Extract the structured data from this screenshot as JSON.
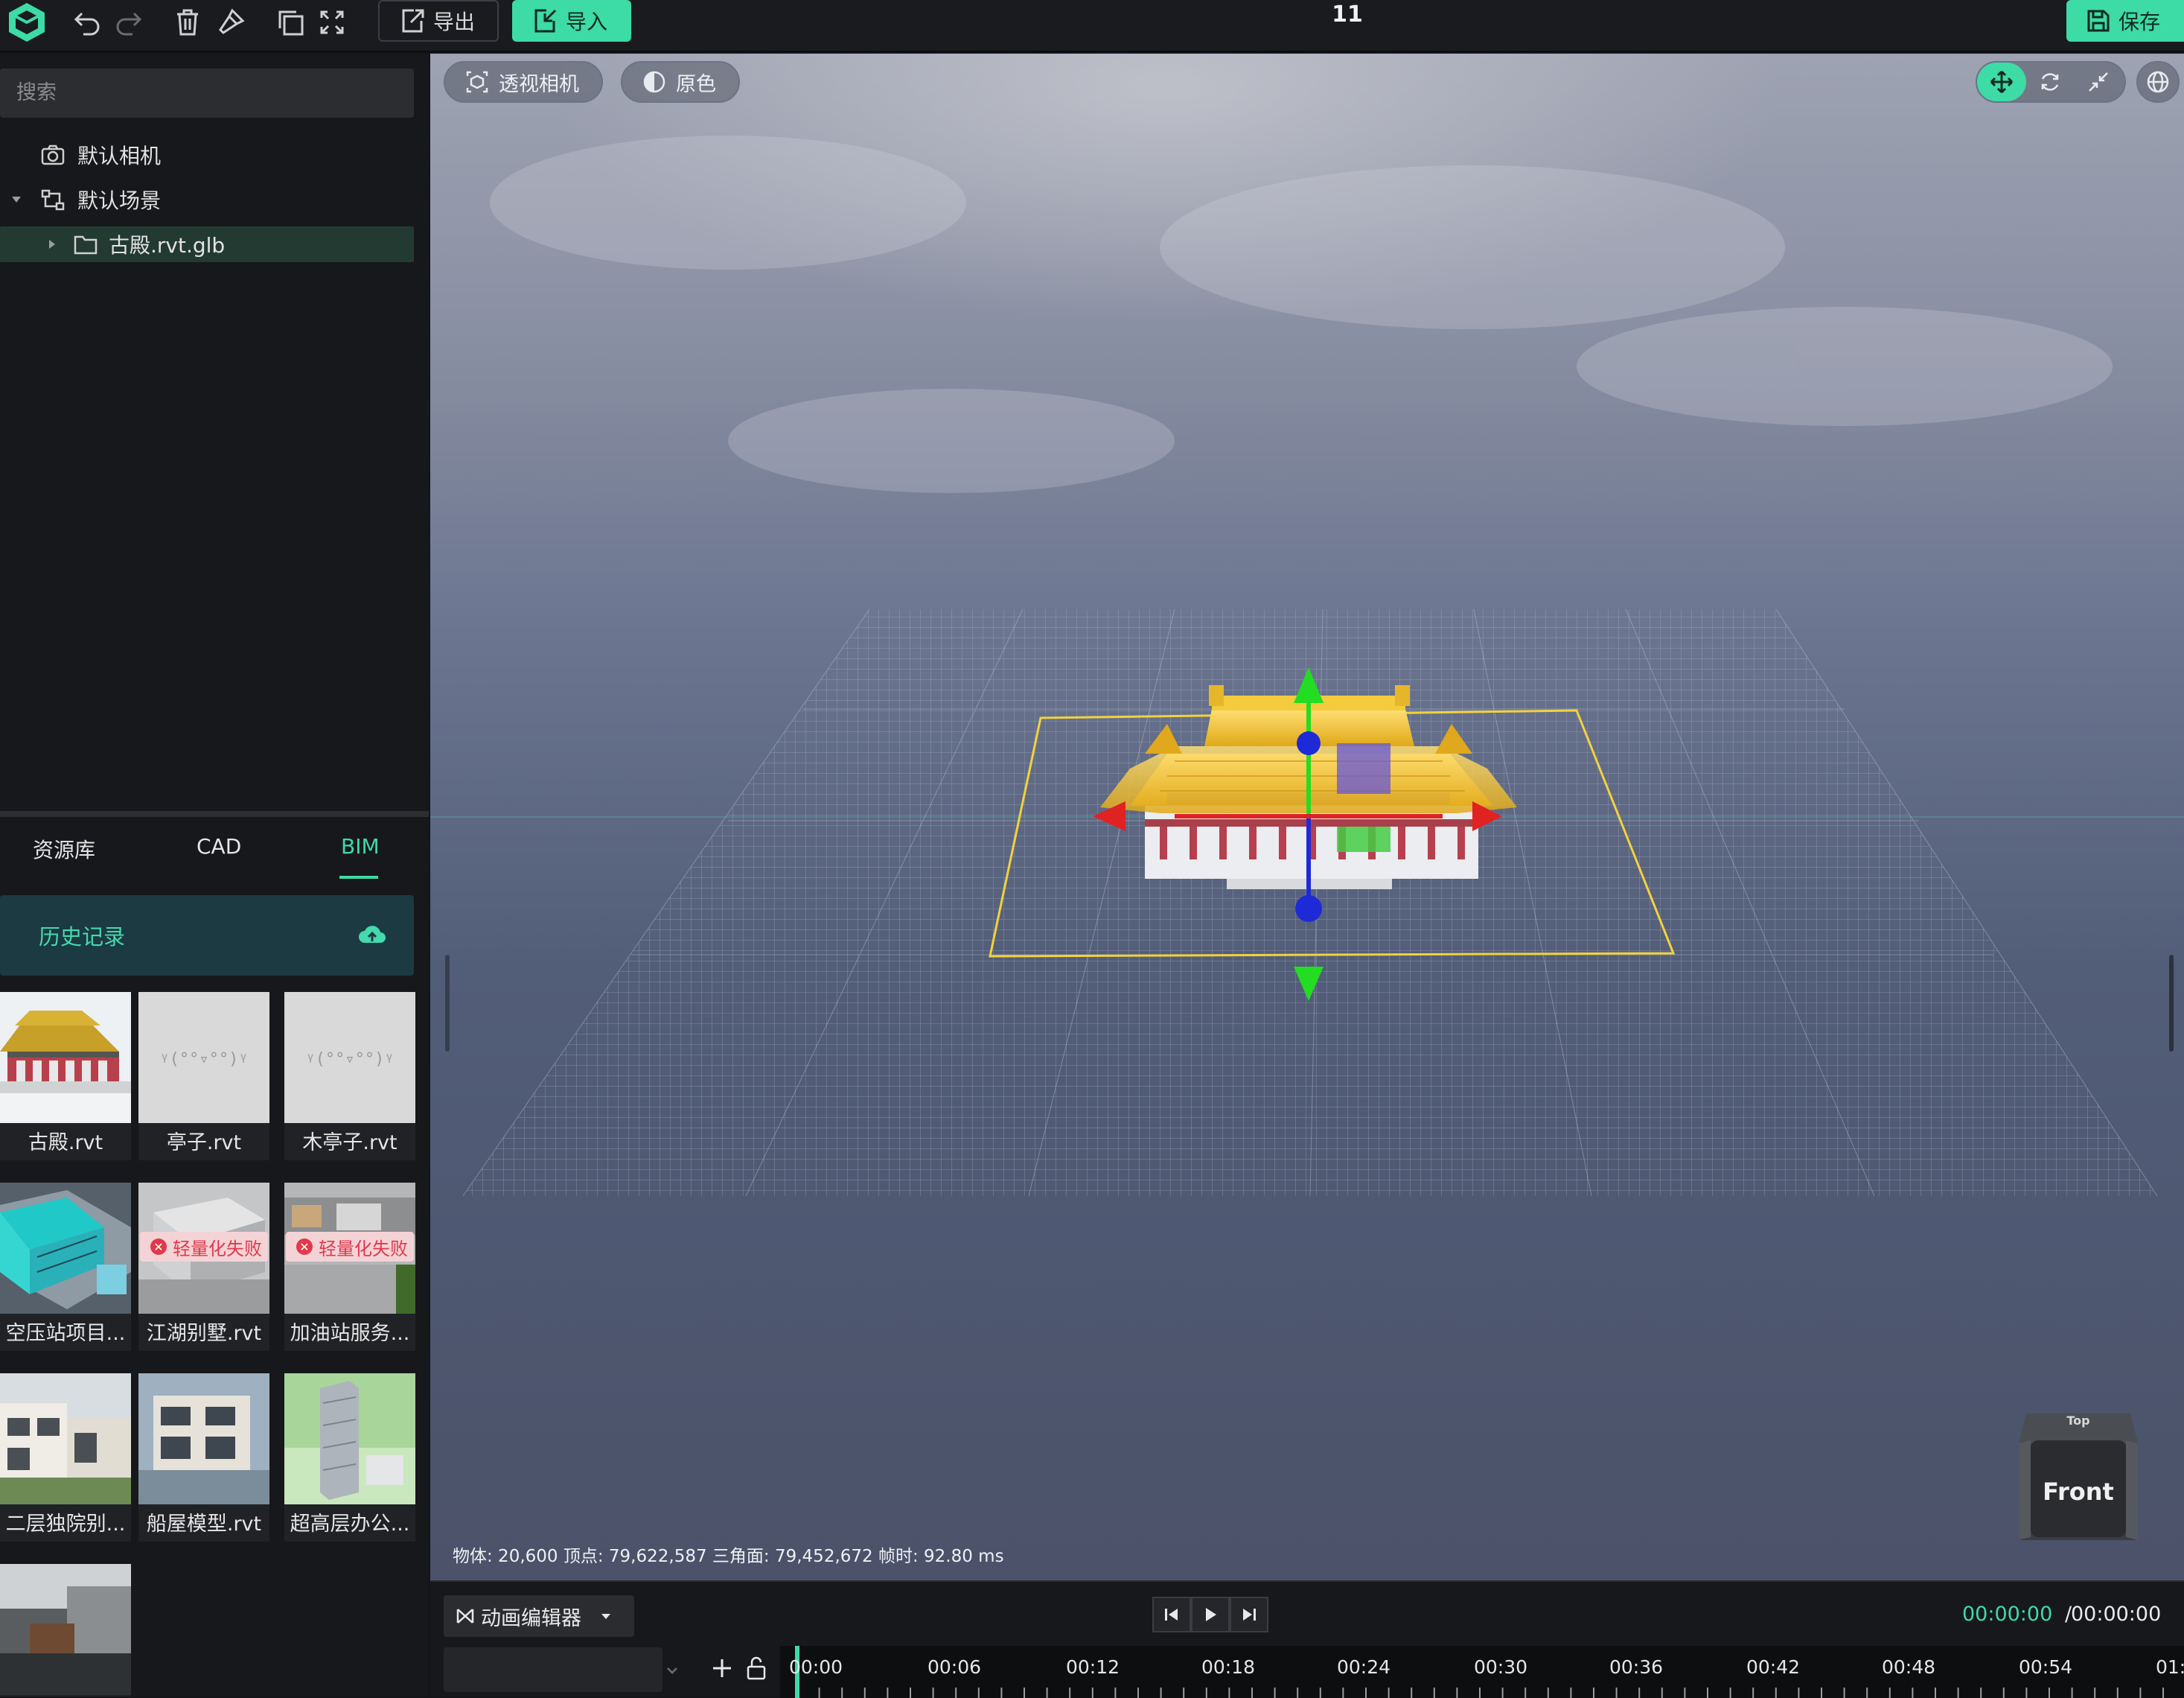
{
  "app": {
    "title": "11"
  },
  "toolbar": {
    "export_label": "导出",
    "import_label": "导入",
    "save_label": "保存"
  },
  "sidebar": {
    "search_placeholder": "搜索",
    "tree": [
      {
        "label": "默认相机",
        "icon": "camera-icon"
      },
      {
        "label": "默认场景",
        "icon": "scene-graph-icon"
      },
      {
        "label": "古殿.rvt.glb",
        "icon": "folder-icon"
      }
    ],
    "tabs": [
      "资源库",
      "CAD",
      "BIM"
    ],
    "active_tab": "BIM",
    "history_label": "历史记录",
    "fail_badge": "轻量化失败",
    "placeholder_face": "ᵞ(°°▿°°)ᵞ",
    "cards": [
      {
        "name": "古殿.rvt",
        "status": "ok"
      },
      {
        "name": "亭子.rvt",
        "status": "placeholder"
      },
      {
        "name": "木亭子.rvt",
        "status": "placeholder"
      },
      {
        "name": "空压站项目...",
        "status": "ok"
      },
      {
        "name": "江湖别墅.rvt",
        "status": "failed"
      },
      {
        "name": "加油站服务...",
        "status": "failed"
      },
      {
        "name": "二层独院别...",
        "status": "ok"
      },
      {
        "name": "船屋模型.rvt",
        "status": "ok"
      },
      {
        "name": "超高层办公...",
        "status": "ok"
      },
      {
        "name": "",
        "status": "ok"
      }
    ]
  },
  "viewport": {
    "camera_label": "透视相机",
    "color_label": "原色",
    "stats": "物体: 20,600  顶点: 79,622,587  三角面: 79,452,672  帧时: 92.80 ms",
    "viewcube_front": "Front",
    "viewcube_top": "Top"
  },
  "timeline": {
    "editor_label": "动画编辑器",
    "current_time": "00:00:00",
    "separator": "/",
    "total_time": "00:00:00",
    "ticks": [
      "00:00",
      "00:06",
      "00:12",
      "00:18",
      "00:24",
      "00:30",
      "00:36",
      "00:42",
      "00:48",
      "00:54",
      "01:"
    ]
  },
  "colors": {
    "accent": "#3ddba6",
    "fail": "#e0394b",
    "selection": "#f2d23c"
  }
}
